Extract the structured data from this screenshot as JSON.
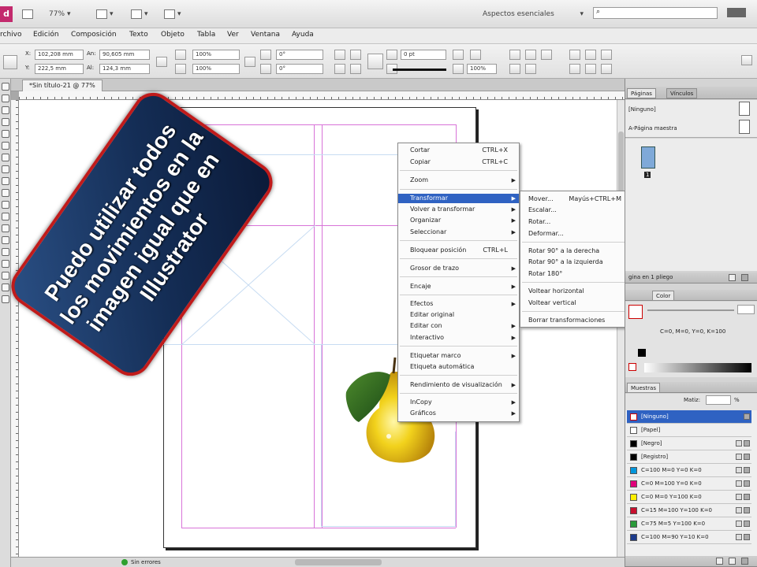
{
  "app": {
    "zoom": "77%",
    "workspace": "Aspectos esenciales",
    "search_placeholder": ""
  },
  "menu": [
    "rchivo",
    "Edición",
    "Composición",
    "Texto",
    "Objeto",
    "Tabla",
    "Ver",
    "Ventana",
    "Ayuda"
  ],
  "control": {
    "x": "102,208 mm",
    "y": "222,5 mm",
    "w": "90,605 mm",
    "h": "124,3 mm",
    "scale_x": "100%",
    "scale_y": "100%",
    "rotate": "0°",
    "shear": "0°",
    "stroke": "0 pt",
    "opacity": "100%"
  },
  "doc_tab": "*Sin título-21 @ 77%",
  "callout": "Puedo utilizar todos los movimientos en la imagen igual que en Illustrator",
  "context_menu": [
    {
      "label": "Cortar",
      "shortcut": "CTRL+X"
    },
    {
      "label": "Copiar",
      "shortcut": "CTRL+C"
    },
    {
      "label": "Zoom",
      "arrow": true
    },
    {
      "label": "Transformar",
      "arrow": true,
      "highlight": true
    },
    {
      "label": "Volver a transformar",
      "arrow": true
    },
    {
      "label": "Organizar",
      "arrow": true
    },
    {
      "label": "Seleccionar",
      "arrow": true
    },
    {
      "label": "Bloquear posición",
      "shortcut": "CTRL+L"
    },
    {
      "label": "Grosor de trazo",
      "arrow": true
    },
    {
      "label": "Encaje",
      "arrow": true
    },
    {
      "label": "Efectos",
      "arrow": true
    },
    {
      "label": "Editar original"
    },
    {
      "label": "Editar con",
      "arrow": true
    },
    {
      "label": "Interactivo",
      "arrow": true
    },
    {
      "label": "Etiquetar marco",
      "arrow": true
    },
    {
      "label": "Etiqueta automática"
    },
    {
      "label": "Rendimiento de visualización",
      "arrow": true
    },
    {
      "label": "InCopy",
      "arrow": true
    },
    {
      "label": "Gráficos",
      "arrow": true
    }
  ],
  "submenu": [
    {
      "label": "Mover...",
      "shortcut": "Mayús+CTRL+M"
    },
    {
      "label": "Escalar..."
    },
    {
      "label": "Rotar..."
    },
    {
      "label": "Deformar..."
    },
    {
      "label": "Rotar 90° a la derecha"
    },
    {
      "label": "Rotar 90° a la izquierda"
    },
    {
      "label": "Rotar 180°"
    },
    {
      "label": "Voltear horizontal"
    },
    {
      "label": "Voltear vertical"
    },
    {
      "label": "Borrar transformaciones"
    }
  ],
  "panels": {
    "pages_tabs": [
      "Páginas",
      "Vínculos"
    ],
    "pages_none": "[Ninguno]",
    "master": "A-Página maestra",
    "page_num": "1",
    "pages_footer": "gina en 1 pliego",
    "color_tab": "Color",
    "color_value": "C=0, M=0, Y=0, K=100",
    "swatches_tab": "Muestras",
    "tint_label": "Matiz:",
    "tint_value": "%",
    "swatches": [
      {
        "name": "[Ninguno]",
        "color": "#ffffff",
        "selected": true
      },
      {
        "name": "[Papel]",
        "color": "#ffffff"
      },
      {
        "name": "[Negro]",
        "color": "#000000"
      },
      {
        "name": "[Registro]",
        "color": "#000000"
      },
      {
        "name": "C=100 M=0 Y=0 K=0",
        "color": "#0096dc"
      },
      {
        "name": "C=0 M=100 Y=0 K=0",
        "color": "#e0007a"
      },
      {
        "name": "C=0 M=0 Y=100 K=0",
        "color": "#ffef00"
      },
      {
        "name": "C=15 M=100 Y=100 K=0",
        "color": "#c8102e"
      },
      {
        "name": "C=75 M=5 Y=100 K=0",
        "color": "#2a9a3a"
      },
      {
        "name": "C=100 M=90 Y=10 K=0",
        "color": "#1d3b8c"
      }
    ]
  },
  "status": {
    "errors": "Sin errores"
  },
  "colors": {
    "highlight": "#2f62c2",
    "callout_border": "#c01b1b",
    "guide": "#d873d8"
  }
}
